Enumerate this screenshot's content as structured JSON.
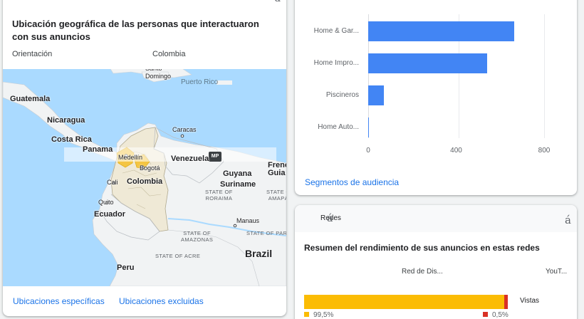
{
  "geo": {
    "corner_glyph": "á",
    "title": "Ubicación geográfica de las personas que interactuaron con sus anuncios",
    "orientation_label": "Orientación",
    "orientation_value": "Colombia",
    "map_badge": "MP",
    "map_labels": {
      "guatemala": "Guatemala",
      "nicaragua": "Nicaragua",
      "costa_rica": "Costa Rica",
      "panama": "Panama",
      "venezuela": "Venezuela",
      "caracas": "Caracas",
      "medellin": "Medellín",
      "bogota": "Bogotá",
      "cali": "Cali",
      "colombia": "Colombia",
      "guyana": "Guyana",
      "suriname": "Suriname",
      "french_guiana": "Frenc\nGuia",
      "ecuador": "Ecuador",
      "quito": "Quito",
      "peru": "Peru",
      "brazil": "Brazil",
      "manaus": "Manaus",
      "santo_domingo": "Santo\nDomingo",
      "puerto_rico": "Puerto Rico",
      "state_roraima": "STATE OF\nRORAIMA",
      "state_amapa": "STATE O\nAMAPÁ",
      "state_amazonas": "STATE OF\nAMAZONAS",
      "state_para": "STATE OF PARÁ",
      "state_acre": "STATE OF ACRE"
    },
    "link_specific": "Ubicaciones específicas",
    "link_excluded": "Ubicaciones excluidas"
  },
  "audience": {
    "link": "Segmentos de audiencia"
  },
  "chart_data": {
    "type": "bar",
    "orientation": "horizontal",
    "categories": [
      "Home & Gar...",
      "Home Impro...",
      "Piscineros",
      "Home Auto..."
    ],
    "values": [
      665,
      540,
      72,
      3
    ],
    "xlim": [
      0,
      800
    ],
    "xticks": [
      0,
      400,
      800
    ],
    "grid": true,
    "color": "#4285f4"
  },
  "networks": {
    "tab_label": "Redes",
    "tab_glyph": "á",
    "corner_glyph": "á",
    "title": "Resumen del rendimiento de sus anuncios en estas redes",
    "col_display": "Red de Dis...",
    "col_youtube": "YouT...",
    "metric": "Vistas",
    "share_display": 99.5,
    "share_youtube": 0.5,
    "legend_display": "99,5%",
    "legend_youtube": "0,5%",
    "color_display": "#fbbc04",
    "color_youtube": "#d93025"
  }
}
